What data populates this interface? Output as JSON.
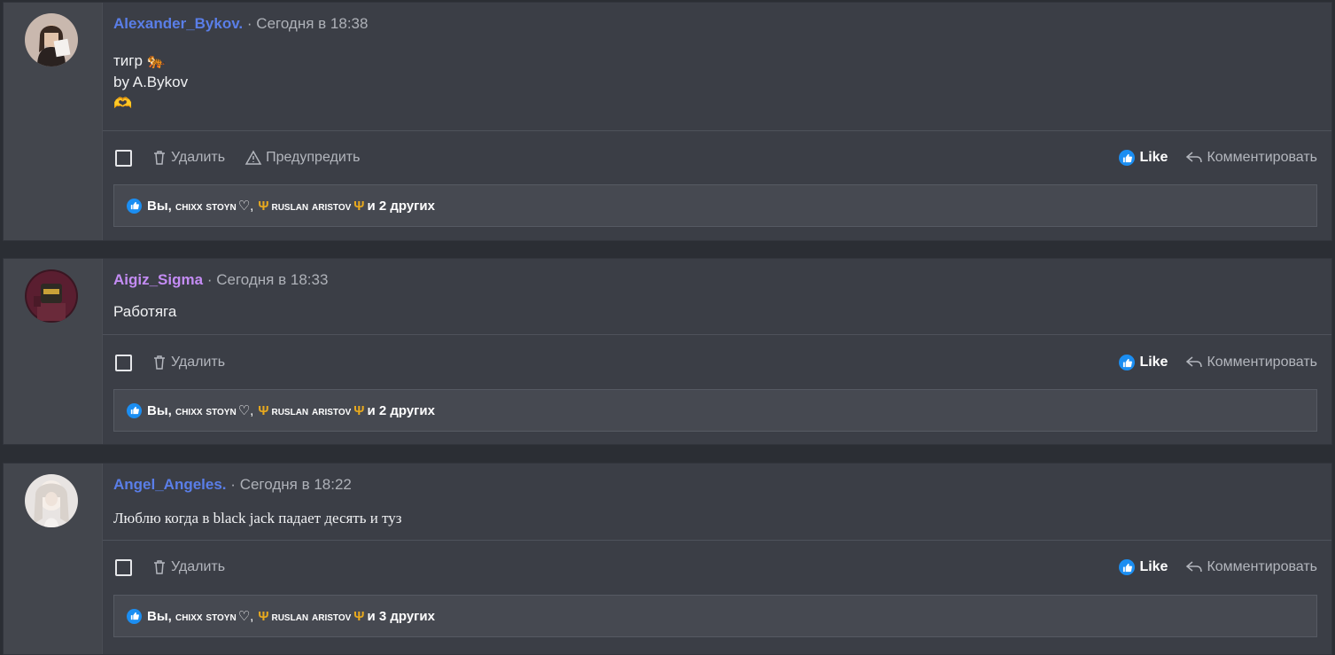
{
  "posts": [
    {
      "username": "Alexander_Bykov.",
      "username_color": "#5a7ee8",
      "separator": "·",
      "time": "Сегодня в 18:38",
      "body_lines": [
        "тигр 🐅",
        "by A.Bykov",
        "🫶"
      ],
      "actions": {
        "delete": "Удалить",
        "warn": "Предупредить",
        "like": "Like",
        "comment": "Комментировать"
      },
      "likes": {
        "prefix": "Вы,",
        "user1": "chixx stoyn",
        "heart": "♡,",
        "user2": "ruslan aristov",
        "suffix": "и 2 других"
      }
    },
    {
      "username": "Aigiz_Sigma",
      "username_color": "#c48cf4",
      "separator": "·",
      "time": "Сегодня в 18:33",
      "body_lines": [
        "Работяга"
      ],
      "actions": {
        "delete": "Удалить",
        "like": "Like",
        "comment": "Комментировать"
      },
      "likes": {
        "prefix": "Вы,",
        "user1": "chixx stoyn",
        "heart": "♡,",
        "user2": "ruslan aristov",
        "suffix": "и 2 других"
      }
    },
    {
      "username": "Angel_Angeles.",
      "username_color": "#5a7ee8",
      "separator": "·",
      "time": "Сегодня в 18:22",
      "body_lines": [
        "Люблю когда в black jack падает десять и туз"
      ],
      "actions": {
        "delete": "Удалить",
        "like": "Like",
        "comment": "Комментировать"
      },
      "likes": {
        "prefix": "Вы,",
        "user1": "chixx stoyn",
        "heart": "♡,",
        "user2": "ruslan aristov",
        "suffix": "и 3 других"
      }
    }
  ]
}
